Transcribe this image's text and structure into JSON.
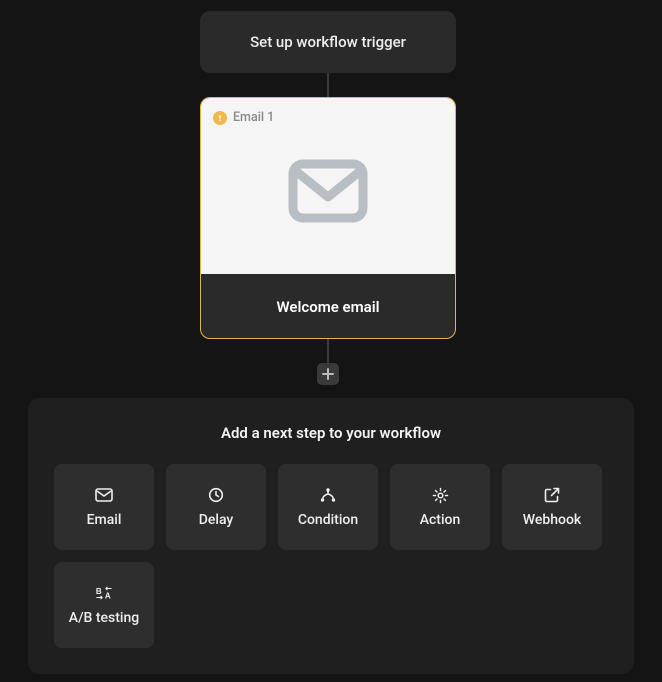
{
  "trigger": {
    "label": "Set up workflow trigger"
  },
  "email_node": {
    "badge": "Email 1",
    "title": "Welcome email"
  },
  "palette": {
    "title": "Add a next step to your workflow",
    "steps": [
      {
        "label": "Email"
      },
      {
        "label": "Delay"
      },
      {
        "label": "Condition"
      },
      {
        "label": "Action"
      },
      {
        "label": "Webhook"
      },
      {
        "label": "A/B testing"
      }
    ]
  }
}
